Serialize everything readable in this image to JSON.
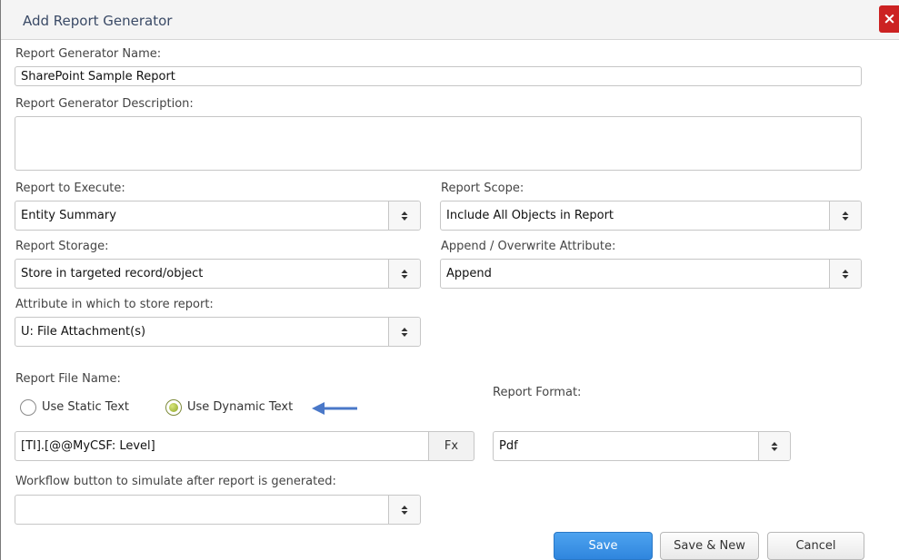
{
  "dialog": {
    "title": "Add Report Generator",
    "close_glyph": "×"
  },
  "fields": {
    "name": {
      "label": "Report Generator Name:",
      "value": "SharePoint Sample Report"
    },
    "description": {
      "label": "Report Generator Description:",
      "value": ""
    },
    "report_to_execute": {
      "label": "Report to Execute:",
      "value": "Entity Summary"
    },
    "report_scope": {
      "label": "Report Scope:",
      "value": "Include All Objects in Report"
    },
    "report_storage": {
      "label": "Report Storage:",
      "value": "Store in targeted record/object"
    },
    "append_overwrite": {
      "label": "Append / Overwrite Attribute:",
      "value": "Append"
    },
    "store_attribute": {
      "label": "Attribute in which to store report:",
      "value": "U: File Attachment(s)"
    },
    "file_name": {
      "label": "Report File Name:",
      "options": [
        {
          "label": "Use Static Text",
          "checked": false
        },
        {
          "label": "Use Dynamic Text",
          "checked": true
        }
      ],
      "value": "[TI].[@@MyCSF: Level]",
      "fx_label": "Fx"
    },
    "report_format": {
      "label": "Report Format:",
      "value": "Pdf"
    },
    "workflow_button": {
      "label": "Workflow button to simulate after report is generated:",
      "value": ""
    }
  },
  "buttons": {
    "save": "Save",
    "save_new": "Save & New",
    "cancel": "Cancel"
  },
  "colors": {
    "primary": "#2f86de",
    "close": "#cc2222",
    "arrow": "#4a78c8",
    "radio_checked": "#8ea52a"
  },
  "icons": {
    "select_arrow": "updown-arrow-icon",
    "annotation": "arrow-left-icon"
  }
}
